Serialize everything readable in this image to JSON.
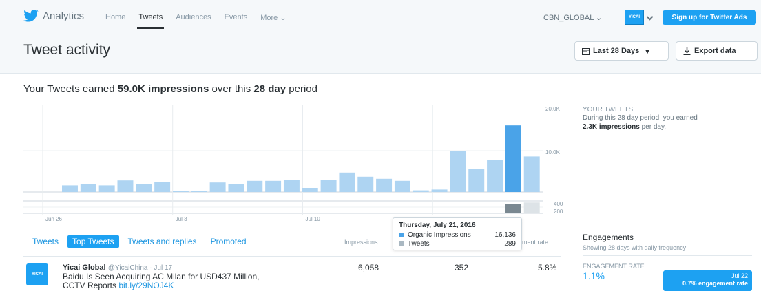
{
  "nav": {
    "brand": "Analytics",
    "links": [
      "Home",
      "Tweets",
      "Audiences",
      "Events",
      "More"
    ],
    "account": "CBN_GLOBAL",
    "avatar_text": "YICAI",
    "signup": "Sign up for Twitter Ads"
  },
  "header": {
    "title": "Tweet activity",
    "date_range": "Last 28 Days",
    "export": "Export data"
  },
  "summary": {
    "prefix": "Your Tweets earned",
    "impressions": "59.0K impressions",
    "middle": "over this",
    "period": "28 day",
    "suffix": "period"
  },
  "side": {
    "title": "YOUR TWEETS",
    "text1": "During this 28 day period, you earned",
    "highlight": "2.3K impressions",
    "text2": "per day."
  },
  "tooltip": {
    "date": "Thursday, July 21, 2016",
    "rows": [
      {
        "name": "Organic Impressions",
        "value": "16,136"
      },
      {
        "name": "Tweets",
        "value": "289"
      }
    ]
  },
  "tabs": [
    "Tweets",
    "Top Tweets",
    "Tweets and replies",
    "Promoted"
  ],
  "columns": {
    "impressions": "Impressions",
    "rate": "ment rate"
  },
  "tweet": {
    "avatar": "YICAI",
    "name": "Yicai Global",
    "handle": "@YicaiChina · Jul 17",
    "text": "Baidu Is Seen Acquiring AC Milan for USD437 Million,",
    "text2": "CCTV Reports",
    "link": "bit.ly/29NOJ4K",
    "impressions": "6,058",
    "engagements": "352",
    "rate": "5.8%"
  },
  "engagements": {
    "title": "Engagements",
    "subtitle": "Showing 28 days with daily frequency",
    "rate_label": "ENGAGEMENT RATE",
    "rate": "1.1%",
    "badge_date": "Jul 22",
    "badge_text": "0.7% engagement rate"
  },
  "chart_data": {
    "type": "bar",
    "x_ticks": [
      "Jun 26",
      "Jul 3",
      "Jul 10"
    ],
    "y_ticks_impressions": [
      "20.0K",
      "10.0K"
    ],
    "y_ticks_tweets": [
      "400",
      "200"
    ],
    "series": [
      {
        "name": "Organic Impressions",
        "color": "#aed4f2",
        "values": [
          1600,
          2000,
          1600,
          2800,
          2000,
          2500,
          200,
          300,
          2300,
          2000,
          2700,
          2700,
          3000,
          1000,
          3000,
          4700,
          3700,
          3200,
          2700,
          400,
          600,
          10000,
          5500,
          7800,
          16136,
          8600
        ]
      },
      {
        "name": "Tweets",
        "color": "#aab8c2",
        "values": [
          0,
          0,
          0,
          0,
          0,
          0,
          0,
          0,
          0,
          0,
          0,
          0,
          0,
          0,
          0,
          0,
          0,
          0,
          0,
          0,
          0,
          0,
          0,
          0,
          289,
          350
        ]
      }
    ],
    "highlight_index": 24,
    "highlight_color": "#4aa3e8",
    "highlight_tweets_color": "#7a8891"
  }
}
